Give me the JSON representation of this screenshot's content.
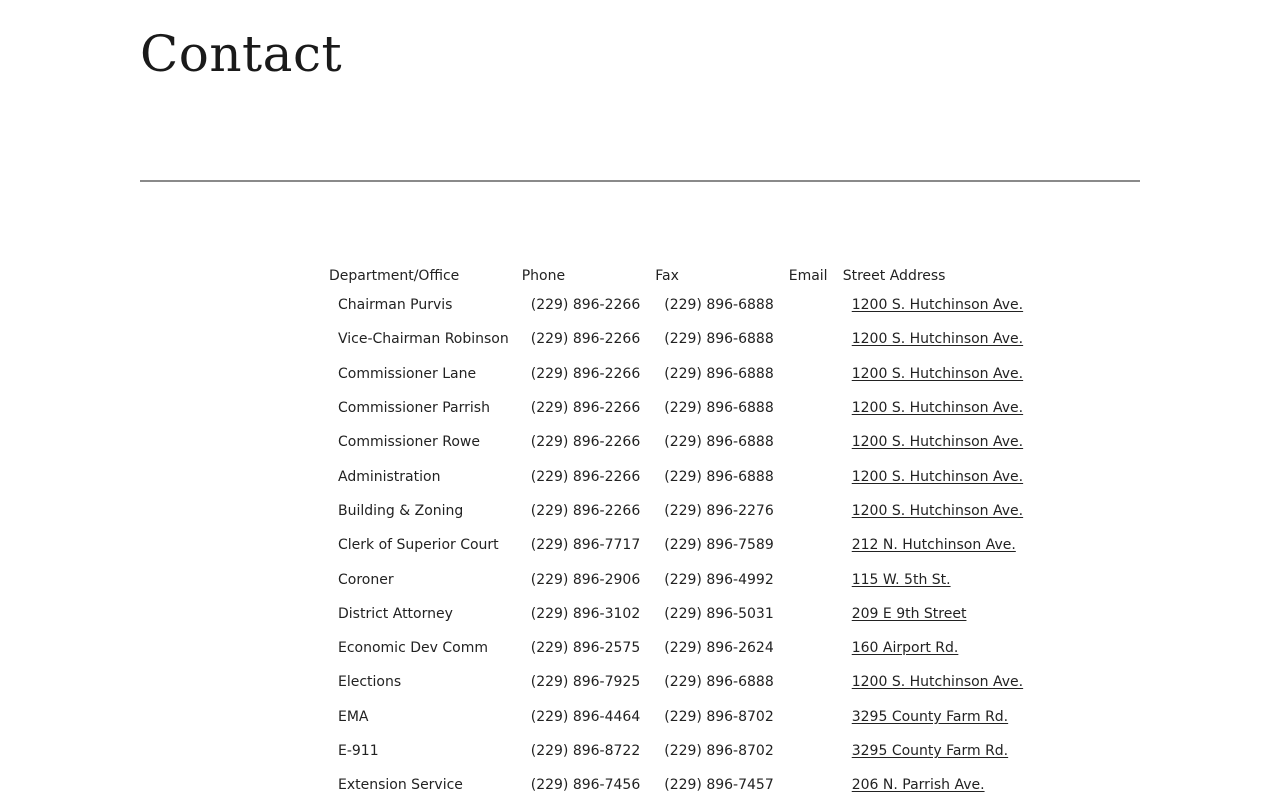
{
  "page": {
    "title": "Contact"
  },
  "table": {
    "headers": {
      "department": "Department/Office",
      "phone": "Phone",
      "fax": "Fax",
      "email": "Email",
      "address": "Street Address"
    },
    "rows": [
      {
        "name": "Chairman Purvis",
        "phone": "(229) 896-2266",
        "fax": "(229) 896-6888",
        "email": "",
        "address": "1200 S. Hutchinson Ave."
      },
      {
        "name": "Vice-Chairman Robinson",
        "phone": "(229) 896-2266",
        "fax": "(229) 896-6888",
        "email": "",
        "address": "1200 S. Hutchinson Ave."
      },
      {
        "name": "Commissioner Lane",
        "phone": "(229) 896-2266",
        "fax": "(229) 896-6888",
        "email": "",
        "address": "1200 S. Hutchinson Ave."
      },
      {
        "name": "Commissioner Parrish",
        "phone": "(229) 896-2266",
        "fax": "(229) 896-6888",
        "email": "",
        "address": "1200 S. Hutchinson Ave."
      },
      {
        "name": "Commissioner Rowe",
        "phone": "(229) 896-2266",
        "fax": "(229) 896-6888",
        "email": "",
        "address": "1200 S. Hutchinson Ave."
      },
      {
        "name": "Administration",
        "phone": "(229) 896-2266",
        "fax": "(229) 896-6888",
        "email": "",
        "address": "1200 S. Hutchinson Ave."
      },
      {
        "name": "Building & Zoning",
        "phone": "(229) 896-2266",
        "fax": "(229) 896-2276",
        "email": "",
        "address": "1200 S. Hutchinson Ave."
      },
      {
        "name": "Clerk of Superior Court",
        "phone": "(229) 896-7717",
        "fax": "(229) 896-7589",
        "email": "",
        "address": "212 N. Hutchinson Ave."
      },
      {
        "name": "Coroner",
        "phone": "(229) 896-2906",
        "fax": "(229) 896-4992",
        "email": "",
        "address": "115 W. 5th St."
      },
      {
        "name": "District Attorney",
        "phone": "(229) 896-3102",
        "fax": "(229) 896-5031",
        "email": "",
        "address": "209 E 9th Street"
      },
      {
        "name": "Economic Dev Comm",
        "phone": "(229) 896-2575",
        "fax": "(229) 896-2624",
        "email": "",
        "address": "160 Airport Rd."
      },
      {
        "name": "Elections",
        "phone": "(229) 896-7925",
        "fax": "(229) 896-6888",
        "email": "",
        "address": "1200 S. Hutchinson Ave."
      },
      {
        "name": "EMA",
        "phone": "(229) 896-4464",
        "fax": "(229) 896-8702",
        "email": "",
        "address": "3295 County Farm Rd."
      },
      {
        "name": "E-911",
        "phone": "(229) 896-8722",
        "fax": "(229) 896-8702",
        "email": "",
        "address": "3295 County Farm Rd."
      },
      {
        "name": "Extension Service",
        "phone": "(229) 896-7456",
        "fax": "(229) 896-7457",
        "email": "",
        "address": "206 N. Parrish Ave."
      }
    ]
  }
}
